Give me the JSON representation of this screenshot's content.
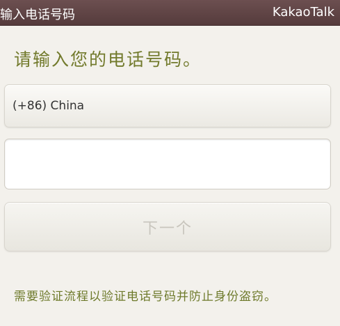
{
  "title_bar": {
    "title": "输入电话号码",
    "app_name": "KakaoTalk"
  },
  "main": {
    "heading": "请输入您的电话号码。",
    "country_select": {
      "value": "(+86) China"
    },
    "phone_input": {
      "value": "",
      "placeholder": ""
    },
    "next_button": {
      "label": "下一个"
    },
    "footer_note": "需要验证流程以验证电话号码并防止身份盗窃。"
  },
  "colors": {
    "title_bar_bg": "#5f4546",
    "heading_text": "#727a2c",
    "page_bg": "#f3f1ec"
  }
}
